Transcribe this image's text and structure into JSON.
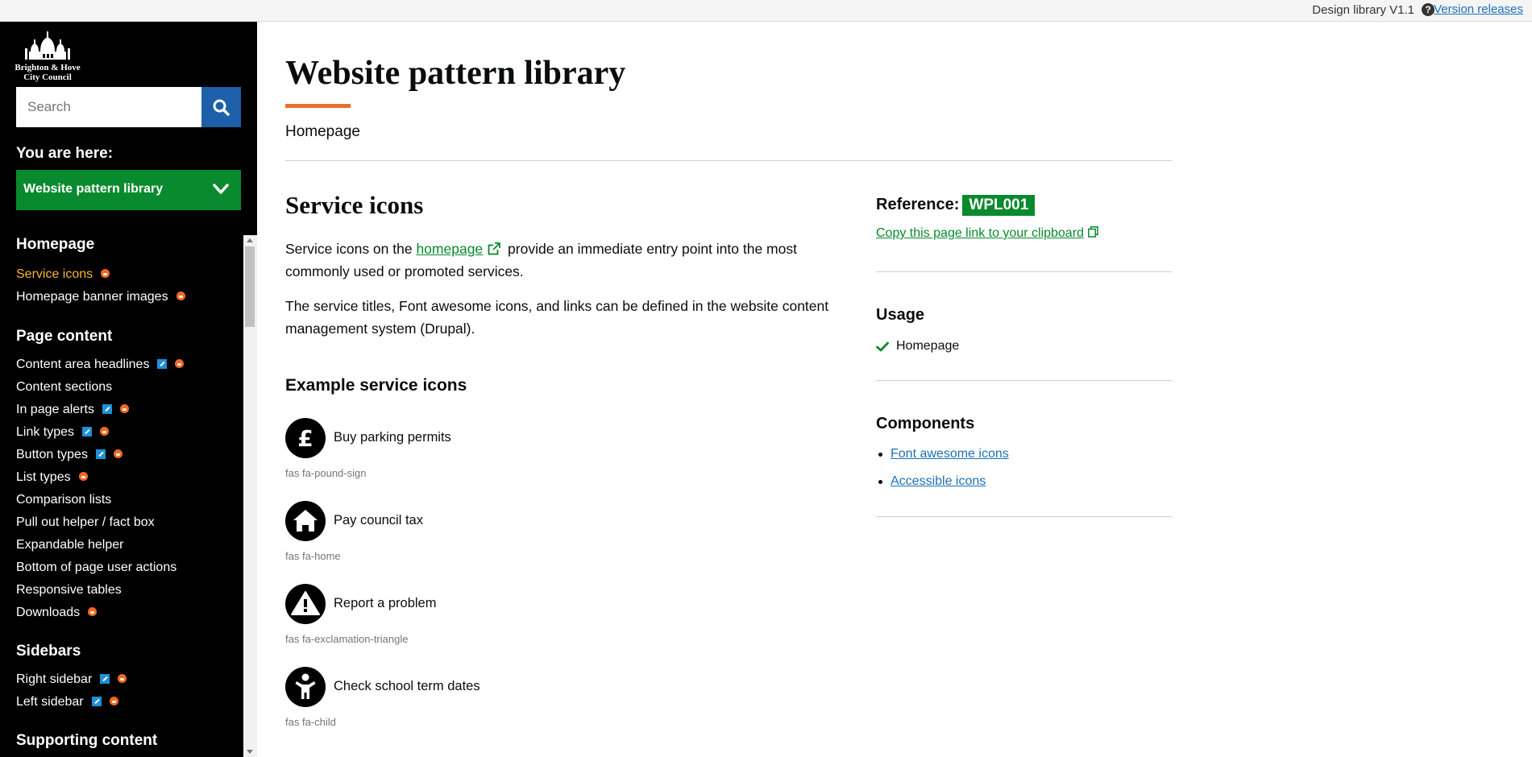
{
  "topbar": {
    "version": "Design library V1.1",
    "help_icon": "question-circle-icon",
    "releases_link": "Version releases"
  },
  "logo": {
    "line1": "Brighton & Hove",
    "line2": "City Council"
  },
  "search": {
    "placeholder": "Search",
    "button_icon": "search-icon"
  },
  "you_are_here": {
    "label": "You are here:",
    "selected": "Website pattern library"
  },
  "nav": {
    "homepage": {
      "heading": "Homepage",
      "items": [
        "Service icons",
        "Homepage banner images"
      ]
    },
    "page_content": {
      "heading": "Page content",
      "items": [
        "Content area headlines",
        "Content sections",
        "In page alerts",
        "Link types",
        "Button types",
        "List types",
        "Comparison lists",
        "Pull out helper / fact box",
        "Expandable helper",
        "Bottom of page user actions",
        "Responsive tables",
        "Downloads"
      ]
    },
    "sidebars": {
      "heading": "Sidebars",
      "items": [
        "Right sidebar",
        "Left sidebar"
      ]
    },
    "supporting_content": {
      "heading": "Supporting content"
    }
  },
  "main": {
    "title": "Website pattern library",
    "breadcrumb": "Homepage",
    "section_title": "Service icons",
    "para1_before": "Service icons on the ",
    "para1_link": "homepage",
    "para1_after": " provide an immediate entry point into the most commonly used or promoted services.",
    "para2": "The service titles, Font awesome icons, and links can be defined in the website content management system (Drupal).",
    "examples_title": "Example service icons",
    "services": [
      {
        "label": "Buy parking permits",
        "class": "fas fa-pound-sign",
        "icon": "pound-sign-icon"
      },
      {
        "label": "Pay council tax",
        "class": "fas fa-home",
        "icon": "home-icon"
      },
      {
        "label": "Report a problem",
        "class": "fas fa-exclamation-triangle",
        "icon": "exclamation-triangle-icon"
      },
      {
        "label": "Check school term dates",
        "class": "fas fa-child",
        "icon": "child-icon"
      }
    ]
  },
  "aside": {
    "reference_label": "Reference:",
    "reference_code": "WPL001",
    "copy_link": "Copy this page link to your clipboard",
    "usage_heading": "Usage",
    "usage_item": "Homepage",
    "components_heading": "Components",
    "components": [
      "Font awesome icons",
      "Accessible icons"
    ]
  },
  "colors": {
    "sidebar_bg": "#000000",
    "active_nav": "#f9b52e",
    "green": "#098a2e",
    "search_button": "#1d5fa8",
    "accent_rule": "#e8712a",
    "link_blue": "#1d70b8"
  }
}
